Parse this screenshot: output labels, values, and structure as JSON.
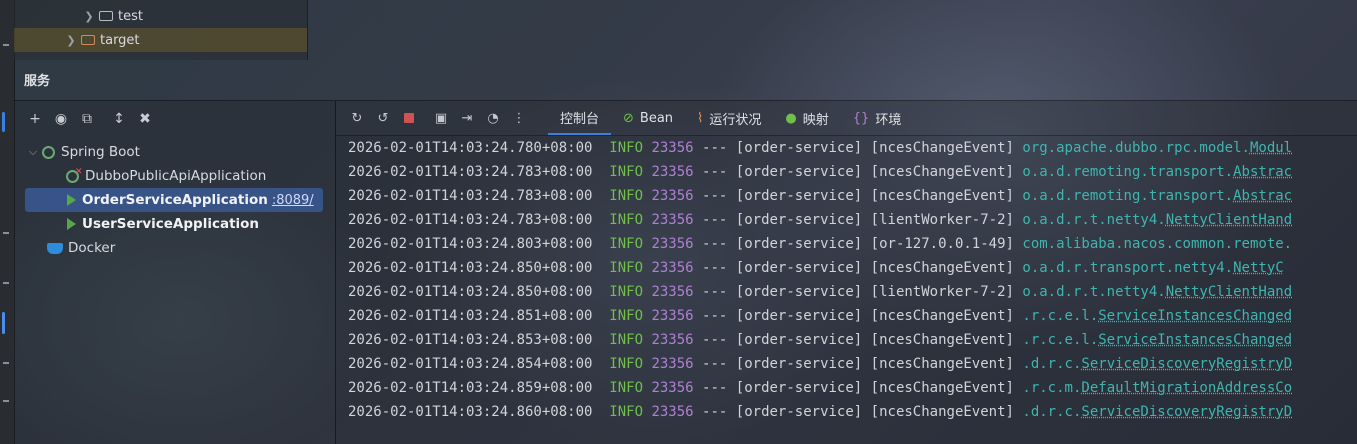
{
  "project_tree": {
    "items": [
      {
        "name": "test",
        "chevron": "chevron-right-icon",
        "icon": "folder-icon"
      },
      {
        "name": "target",
        "chevron": "chevron-right-icon",
        "icon": "folder-orange-icon"
      }
    ]
  },
  "services": {
    "title": "服务",
    "tree": {
      "spring_boot": "Spring Boot",
      "apps": [
        {
          "name": "DubboPublicApiApplication",
          "state": "error"
        },
        {
          "name": "OrderServiceApplication",
          "port": ":8089/",
          "state": "running",
          "selected": true
        },
        {
          "name": "UserServiceApplication",
          "state": "running"
        }
      ],
      "docker": "Docker"
    }
  },
  "console": {
    "tabs": [
      {
        "label": "控制台",
        "active": true
      },
      {
        "label": "Bean",
        "icon": "bean-icon"
      },
      {
        "label": "运行状况",
        "icon": "health-icon"
      },
      {
        "label": "映射",
        "icon": "mapping-icon"
      },
      {
        "label": "环境",
        "icon": "env-icon"
      }
    ],
    "lines": [
      {
        "ts": "2026-02-01T14:03:24.780+08:00",
        "level": "INFO",
        "pid": "23356",
        "sep": "---",
        "app": "[order-service]",
        "thread": "[ncesChangeEvent]",
        "logger": "org.apache.dubbo.rpc.model.",
        "logger_link": "Modul"
      },
      {
        "ts": "2026-02-01T14:03:24.783+08:00",
        "level": "INFO",
        "pid": "23356",
        "sep": "---",
        "app": "[order-service]",
        "thread": "[ncesChangeEvent]",
        "logger": "o.a.d.remoting.transport.",
        "logger_link": "Abstrac"
      },
      {
        "ts": "2026-02-01T14:03:24.783+08:00",
        "level": "INFO",
        "pid": "23356",
        "sep": "---",
        "app": "[order-service]",
        "thread": "[ncesChangeEvent]",
        "logger": "o.a.d.remoting.transport.",
        "logger_link": "Abstrac"
      },
      {
        "ts": "2026-02-01T14:03:24.783+08:00",
        "level": "INFO",
        "pid": "23356",
        "sep": "---",
        "app": "[order-service]",
        "thread": "[lientWorker-7-2]",
        "logger": "o.a.d.r.t.netty4.",
        "logger_link": "NettyClientHand"
      },
      {
        "ts": "2026-02-01T14:03:24.803+08:00",
        "level": "INFO",
        "pid": "23356",
        "sep": "---",
        "app": "[order-service]",
        "thread": "[or-127.0.0.1-49]",
        "logger": "com.alibaba.nacos.common.remote.",
        "logger_link": ""
      },
      {
        "ts": "2026-02-01T14:03:24.850+08:00",
        "level": "INFO",
        "pid": "23356",
        "sep": "---",
        "app": "[order-service]",
        "thread": "[ncesChangeEvent]",
        "logger": "o.a.d.r.transport.netty4.",
        "logger_link": "NettyC"
      },
      {
        "ts": "2026-02-01T14:03:24.850+08:00",
        "level": "INFO",
        "pid": "23356",
        "sep": "---",
        "app": "[order-service]",
        "thread": "[lientWorker-7-2]",
        "logger": "o.a.d.r.t.netty4.",
        "logger_link": "NettyClientHand"
      },
      {
        "ts": "2026-02-01T14:03:24.851+08:00",
        "level": "INFO",
        "pid": "23356",
        "sep": "---",
        "app": "[order-service]",
        "thread": "[ncesChangeEvent]",
        "logger": ".r.c.e.l.",
        "logger_link": "ServiceInstancesChanged"
      },
      {
        "ts": "2026-02-01T14:03:24.853+08:00",
        "level": "INFO",
        "pid": "23356",
        "sep": "---",
        "app": "[order-service]",
        "thread": "[ncesChangeEvent]",
        "logger": ".r.c.e.l.",
        "logger_link": "ServiceInstancesChanged"
      },
      {
        "ts": "2026-02-01T14:03:24.854+08:00",
        "level": "INFO",
        "pid": "23356",
        "sep": "---",
        "app": "[order-service]",
        "thread": "[ncesChangeEvent]",
        "logger": ".d.r.c.",
        "logger_link": "ServiceDiscoveryRegistryD"
      },
      {
        "ts": "2026-02-01T14:03:24.859+08:00",
        "level": "INFO",
        "pid": "23356",
        "sep": "---",
        "app": "[order-service]",
        "thread": "[ncesChangeEvent]",
        "logger": ".r.c.m.",
        "logger_link": "DefaultMigrationAddressCo"
      },
      {
        "ts": "2026-02-01T14:03:24.860+08:00",
        "level": "INFO",
        "pid": "23356",
        "sep": "---",
        "app": "[order-service]",
        "thread": "[ncesChangeEvent]",
        "logger": ".d.r.c.",
        "logger_link": "ServiceDiscoveryRegistryD"
      }
    ]
  },
  "colors": {
    "info": "#6fbf4a",
    "pid": "#b17fd6",
    "logger": "#3fb5b0",
    "selection": "#3c5fa0",
    "accent": "#3d7fe0"
  }
}
